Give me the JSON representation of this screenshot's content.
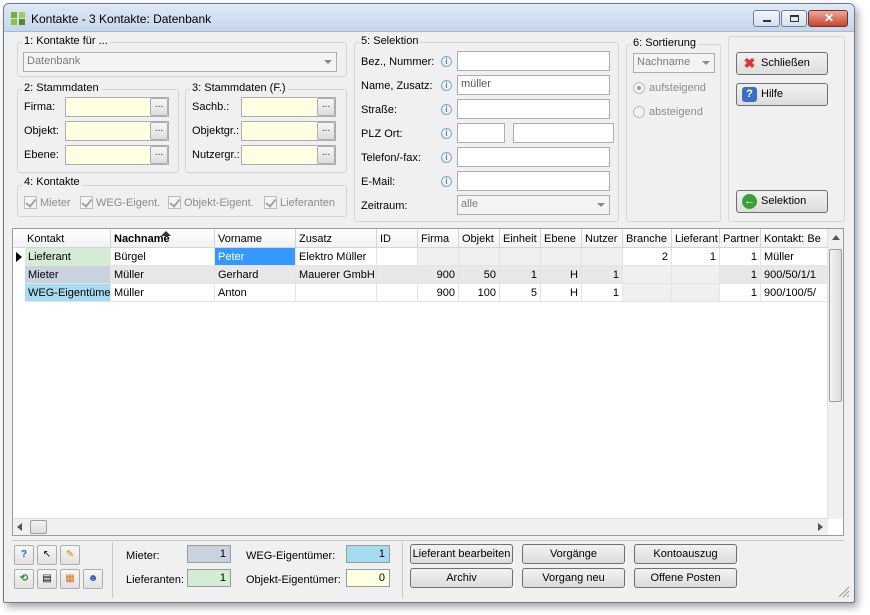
{
  "window": {
    "title": "Kontakte - 3 Kontakte:  Datenbank"
  },
  "kontakte_fuer": {
    "legend": "1: Kontakte für ...",
    "value": "Datenbank"
  },
  "stammdaten": {
    "legend": "2: Stammdaten",
    "firma_label": "Firma:",
    "objekt_label": "Objekt:",
    "ebene_label": "Ebene:"
  },
  "stammdaten_f": {
    "legend": "3: Stammdaten (F.)",
    "sachb_label": "Sachb.:",
    "objektgr_label": "Objektgr.:",
    "nutzergr_label": "Nutzergr.:"
  },
  "kontakte": {
    "legend": "4: Kontakte",
    "mieter": "Mieter",
    "weg": "WEG-Eigent.",
    "objekt_eigent": "Objekt-Eigent.",
    "lieferanten": "Lieferanten"
  },
  "selektion": {
    "legend": "5: Selektion",
    "bez_label": "Bez., Nummer:",
    "name_label": "Name, Zusatz:",
    "name_value": "müller",
    "strasse_label": "Straße:",
    "plz_label": "PLZ Ort:",
    "telefon_label": "Telefon/-fax:",
    "email_label": "E-Mail:",
    "zeitraum_label": "Zeitraum:",
    "zeitraum_value": "alle"
  },
  "sortierung": {
    "legend": "6: Sortierung",
    "value": "Nachname",
    "aufsteigend": "aufsteigend",
    "absteigend": "absteigend"
  },
  "buttons": {
    "schliessen": "Schließen",
    "hilfe": "Hilfe",
    "selektion": "Selektion",
    "lieferant_bearbeiten": "Lieferant bearbeiten",
    "vorgaenge": "Vorgänge",
    "kontoauszug": "Kontoauszug",
    "archiv": "Archiv",
    "vorgang_neu": "Vorgang neu",
    "offene_posten": "Offene Posten"
  },
  "grid": {
    "headers": [
      "Kontakt",
      "Nachname",
      "Vorname",
      "Zusatz",
      "ID",
      "Firma",
      "Objekt",
      "Einheit",
      "Ebene",
      "Nutzer",
      "Branche",
      "Lieferant",
      "Partner",
      "Kontakt: Be"
    ],
    "rows": [
      [
        "Lieferant",
        "Bürgel",
        "Peter",
        "Elektro Müller",
        "",
        "",
        "",
        "",
        "",
        "",
        "2",
        "1",
        "1",
        "Müller"
      ],
      [
        "Mieter",
        "Müller",
        "Gerhard",
        "Mauerer GmbH",
        "",
        "900",
        "50",
        "1",
        "H",
        "1",
        "",
        "",
        "1",
        "900/50/1/1"
      ],
      [
        "WEG-Eigentümer",
        "Müller",
        "Anton",
        "",
        "",
        "900",
        "100",
        "5",
        "H",
        "1",
        "",
        "",
        "1",
        "900/100/5/"
      ]
    ]
  },
  "counts": {
    "mieter_label": "Mieter:",
    "mieter_value": "1",
    "lieferanten_label": "Lieferanten:",
    "lieferanten_value": "1",
    "weg_label": "WEG-Eigentümer:",
    "weg_value": "1",
    "objekt_label": "Objekt-Eigentümer:",
    "objekt_value": "0"
  },
  "colors": {
    "lieferant": "#d5ecd4",
    "mieter": "#c9d3df",
    "weg": "#a6dcf0",
    "selected_cell": "#3399ff",
    "yellow_field": "#ffffe1"
  }
}
